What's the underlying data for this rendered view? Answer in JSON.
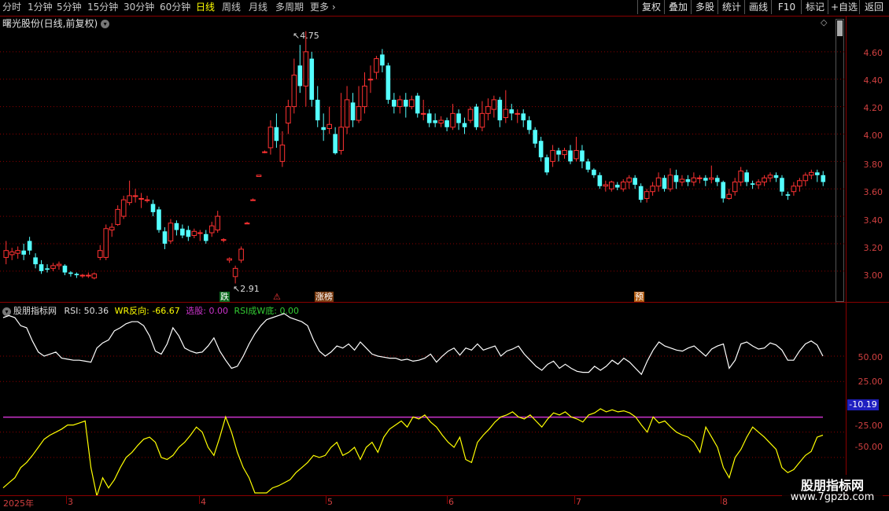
{
  "toolbar": {
    "periods": [
      "分时",
      "1分钟",
      "5分钟",
      "15分钟",
      "30分钟",
      "60分钟",
      "日线",
      "周线",
      "月线",
      "多周期",
      "更多"
    ],
    "active_period": "日线",
    "buttons": [
      "复权",
      "叠加",
      "多股",
      "统计",
      "画线",
      "F10",
      "标记",
      "+自选",
      "返回"
    ]
  },
  "chart": {
    "title": "曙光股份(日线,前复权)",
    "high_label": "4.75",
    "low_label": "2.91",
    "events": [
      {
        "text": "跌",
        "bg": "#0b6a1e",
        "color": "#ffffff"
      },
      {
        "text": "⚠",
        "bg": "#000000",
        "color": "#ff3a3a"
      },
      {
        "text": "涨榜",
        "bg": "#7a3b10",
        "color": "#ffffff"
      },
      {
        "text": "预",
        "bg": "#b05a10",
        "color": "#ffffff"
      }
    ],
    "xlabels": [
      "2025年",
      "3",
      "4",
      "5",
      "6",
      "7",
      "8"
    ]
  },
  "indicator": {
    "name": "股朋指标网",
    "rsi_label": "RSI:",
    "rsi_value": "50.36",
    "wr_label": "WR反向:",
    "wr_value": "-66.67",
    "sel_label": "选股:",
    "sel_value": "0.00",
    "w_label": "RSI成W底:",
    "w_value": "0.00",
    "current_value": "-10.19"
  },
  "watermark": {
    "line1": "股朋指标网",
    "line2": "www.7gpzb.com"
  },
  "colors": {
    "up": "#ff3232",
    "down": "#54ffff",
    "rsi": "#ffffff",
    "wr": "#ffff00",
    "magenta": "#cc33cc",
    "grid": "#8b0000"
  },
  "chart_data": [
    {
      "type": "candlestick",
      "title": "曙光股份(日线,前复权)",
      "ylim": [
        2.85,
        4.8
      ],
      "yticks": [
        3.0,
        3.2,
        3.4,
        3.6,
        3.8,
        4.0,
        4.2,
        4.4,
        4.6
      ],
      "ytick_labels": [
        "3.00",
        "3.20",
        "3.40",
        "3.60",
        "3.80",
        "4.00",
        "4.20",
        "4.40",
        "4.60"
      ],
      "x_labels": [
        "2025年",
        "3",
        "4",
        "5",
        "6",
        "7",
        "8"
      ],
      "annotations": [
        {
          "text": "4.75",
          "value": 4.75
        },
        {
          "text": "2.91",
          "value": 2.91
        }
      ],
      "ohlc": [
        [
          3.1,
          3.15,
          3.05,
          3.22
        ],
        [
          3.12,
          3.14,
          3.08,
          3.17
        ],
        [
          3.13,
          3.15,
          3.09,
          3.18
        ],
        [
          3.15,
          3.12,
          3.08,
          3.2
        ],
        [
          3.22,
          3.15,
          3.12,
          3.25
        ],
        [
          3.1,
          3.05,
          3.02,
          3.13
        ],
        [
          3.05,
          3.0,
          2.98,
          3.08
        ],
        [
          3.02,
          3.01,
          2.99,
          3.05
        ],
        [
          3.02,
          3.04,
          3.0,
          3.06
        ],
        [
          3.04,
          3.05,
          3.01,
          3.07
        ],
        [
          3.04,
          2.99,
          2.97,
          3.05
        ],
        [
          2.99,
          2.98,
          2.96,
          3.0
        ],
        [
          2.98,
          2.97,
          2.95,
          2.99
        ],
        [
          2.97,
          2.97,
          2.95,
          2.98
        ],
        [
          2.97,
          2.97,
          2.95,
          2.99
        ],
        [
          2.95,
          2.98,
          2.94,
          2.99
        ],
        [
          3.1,
          3.15,
          3.08,
          3.19
        ],
        [
          3.1,
          3.31,
          3.08,
          3.34
        ],
        [
          3.3,
          3.32,
          3.25,
          3.35
        ],
        [
          3.34,
          3.45,
          3.33,
          3.48
        ],
        [
          3.4,
          3.52,
          3.38,
          3.55
        ],
        [
          3.5,
          3.55,
          3.48,
          3.66
        ],
        [
          3.55,
          3.55,
          3.5,
          3.6
        ],
        [
          3.53,
          3.53,
          3.46,
          3.57
        ],
        [
          3.52,
          3.52,
          3.5,
          3.55
        ],
        [
          3.49,
          3.43,
          3.4,
          3.52
        ],
        [
          3.45,
          3.3,
          3.28,
          3.47
        ],
        [
          3.29,
          3.2,
          3.16,
          3.32
        ],
        [
          3.22,
          3.35,
          3.2,
          3.38
        ],
        [
          3.35,
          3.3,
          3.26,
          3.37
        ],
        [
          3.31,
          3.26,
          3.24,
          3.34
        ],
        [
          3.3,
          3.25,
          3.22,
          3.33
        ],
        [
          3.26,
          3.29,
          3.24,
          3.31
        ],
        [
          3.28,
          3.28,
          3.22,
          3.3
        ],
        [
          3.27,
          3.22,
          3.2,
          3.3
        ],
        [
          3.28,
          3.33,
          3.25,
          3.36
        ],
        [
          3.3,
          3.4,
          3.28,
          3.44
        ],
        [
          3.23,
          3.23,
          3.21,
          3.24
        ],
        [
          3.08,
          3.09,
          3.06,
          3.1
        ],
        [
          2.96,
          3.02,
          2.91,
          3.04
        ],
        [
          3.08,
          3.16,
          3.06,
          3.18
        ],
        [
          3.35,
          3.35,
          3.35,
          3.36
        ],
        [
          3.52,
          3.52,
          3.52,
          3.53
        ],
        [
          3.69,
          3.7,
          3.69,
          3.7
        ],
        [
          3.87,
          3.87,
          3.86,
          3.88
        ],
        [
          3.9,
          4.05,
          3.85,
          4.1
        ],
        [
          4.05,
          3.95,
          3.9,
          4.15
        ],
        [
          3.8,
          3.92,
          3.76,
          4.02
        ],
        [
          4.08,
          4.2,
          4.0,
          4.25
        ],
        [
          4.2,
          4.43,
          4.15,
          4.55
        ],
        [
          4.5,
          4.35,
          4.3,
          4.65
        ],
        [
          4.35,
          4.6,
          4.2,
          4.75
        ],
        [
          4.55,
          4.25,
          4.2,
          4.6
        ],
        [
          4.25,
          4.1,
          4.05,
          4.35
        ],
        [
          4.05,
          4.03,
          3.95,
          4.15
        ],
        [
          4.04,
          4.07,
          4.0,
          4.2
        ],
        [
          4.0,
          3.86,
          3.85,
          4.05
        ],
        [
          3.88,
          4.05,
          3.85,
          4.3
        ],
        [
          4.05,
          4.25,
          4.0,
          4.35
        ],
        [
          4.23,
          4.1,
          4.05,
          4.3
        ],
        [
          4.1,
          4.2,
          4.08,
          4.35
        ],
        [
          4.2,
          4.35,
          4.15,
          4.45
        ],
        [
          4.4,
          4.4,
          4.3,
          4.5
        ],
        [
          4.45,
          4.55,
          4.4,
          4.57
        ],
        [
          4.58,
          4.5,
          4.45,
          4.62
        ],
        [
          4.5,
          4.25,
          4.22,
          4.52
        ],
        [
          4.25,
          4.2,
          4.15,
          4.3
        ],
        [
          4.2,
          4.25,
          4.15,
          4.28
        ],
        [
          4.25,
          4.2,
          4.12,
          4.3
        ],
        [
          4.2,
          4.25,
          4.18,
          4.28
        ],
        [
          4.28,
          4.15,
          4.12,
          4.3
        ],
        [
          4.15,
          4.15,
          4.1,
          4.25
        ],
        [
          4.15,
          4.08,
          4.05,
          4.18
        ],
        [
          4.1,
          4.08,
          4.05,
          4.15
        ],
        [
          4.08,
          4.1,
          4.05,
          4.13
        ],
        [
          4.1,
          4.05,
          4.02,
          4.12
        ],
        [
          4.05,
          4.15,
          4.03,
          4.22
        ],
        [
          4.15,
          4.08,
          4.03,
          4.18
        ],
        [
          4.08,
          4.05,
          4.0,
          4.12
        ],
        [
          4.1,
          4.18,
          4.08,
          4.2
        ],
        [
          4.2,
          4.05,
          4.03,
          4.22
        ],
        [
          4.05,
          4.15,
          4.02,
          4.24
        ],
        [
          4.15,
          4.2,
          4.1,
          4.26
        ],
        [
          4.18,
          4.25,
          4.12,
          4.28
        ],
        [
          4.25,
          4.1,
          4.05,
          4.27
        ],
        [
          4.12,
          4.18,
          4.08,
          4.32
        ],
        [
          4.18,
          4.15,
          4.1,
          4.22
        ],
        [
          4.15,
          4.15,
          4.08,
          4.18
        ],
        [
          4.15,
          4.1,
          4.05,
          4.18
        ],
        [
          4.1,
          4.03,
          4.0,
          4.13
        ],
        [
          4.03,
          3.93,
          3.9,
          4.05
        ],
        [
          3.95,
          3.83,
          3.8,
          3.98
        ],
        [
          3.83,
          3.72,
          3.7,
          3.85
        ],
        [
          3.8,
          3.88,
          3.76,
          3.92
        ],
        [
          3.88,
          3.85,
          3.8,
          3.9
        ],
        [
          3.85,
          3.88,
          3.82,
          3.9
        ],
        [
          3.88,
          3.8,
          3.78,
          3.92
        ],
        [
          3.82,
          3.88,
          3.8,
          3.98
        ],
        [
          3.88,
          3.8,
          3.75,
          3.92
        ],
        [
          3.8,
          3.74,
          3.72,
          3.82
        ],
        [
          3.74,
          3.7,
          3.68,
          3.75
        ],
        [
          3.7,
          3.62,
          3.6,
          3.72
        ],
        [
          3.62,
          3.63,
          3.58,
          3.66
        ],
        [
          3.6,
          3.65,
          3.58,
          3.66
        ],
        [
          3.63,
          3.61,
          3.59,
          3.65
        ],
        [
          3.6,
          3.65,
          3.58,
          3.67
        ],
        [
          3.65,
          3.68,
          3.6,
          3.7
        ],
        [
          3.68,
          3.63,
          3.6,
          3.7
        ],
        [
          3.62,
          3.52,
          3.5,
          3.64
        ],
        [
          3.53,
          3.58,
          3.5,
          3.6
        ],
        [
          3.58,
          3.62,
          3.55,
          3.65
        ],
        [
          3.62,
          3.68,
          3.58,
          3.72
        ],
        [
          3.68,
          3.6,
          3.58,
          3.7
        ],
        [
          3.6,
          3.7,
          3.58,
          3.75
        ],
        [
          3.7,
          3.65,
          3.6,
          3.74
        ],
        [
          3.65,
          3.67,
          3.62,
          3.7
        ],
        [
          3.67,
          3.65,
          3.62,
          3.7
        ],
        [
          3.65,
          3.68,
          3.62,
          3.72
        ],
        [
          3.68,
          3.68,
          3.64,
          3.7
        ],
        [
          3.68,
          3.66,
          3.62,
          3.7
        ],
        [
          3.67,
          3.68,
          3.64,
          3.77
        ],
        [
          3.68,
          3.65,
          3.62,
          3.7
        ],
        [
          3.65,
          3.53,
          3.5,
          3.66
        ],
        [
          3.53,
          3.56,
          3.52,
          3.6
        ],
        [
          3.58,
          3.65,
          3.55,
          3.68
        ],
        [
          3.65,
          3.73,
          3.62,
          3.76
        ],
        [
          3.72,
          3.65,
          3.62,
          3.74
        ],
        [
          3.64,
          3.63,
          3.6,
          3.66
        ],
        [
          3.63,
          3.65,
          3.6,
          3.67
        ],
        [
          3.65,
          3.68,
          3.62,
          3.7
        ],
        [
          3.68,
          3.7,
          3.65,
          3.72
        ],
        [
          3.7,
          3.68,
          3.65,
          3.72
        ],
        [
          3.68,
          3.58,
          3.55,
          3.7
        ],
        [
          3.56,
          3.55,
          3.52,
          3.58
        ],
        [
          3.58,
          3.62,
          3.55,
          3.65
        ],
        [
          3.62,
          3.66,
          3.58,
          3.68
        ],
        [
          3.66,
          3.7,
          3.62,
          3.72
        ],
        [
          3.7,
          3.72,
          3.67,
          3.74
        ],
        [
          3.72,
          3.7,
          3.65,
          3.74
        ],
        [
          3.7,
          3.65,
          3.62,
          3.73
        ]
      ]
    },
    {
      "type": "line",
      "title": "股朋指标网",
      "ylim": [
        -85,
        95
      ],
      "ytick_labels": [
        "50.00",
        "25.00",
        "-25.00",
        "-50.00"
      ],
      "reference_line": -10.19,
      "series": [
        {
          "name": "RSI",
          "values": [
            88,
            90,
            88,
            80,
            78,
            65,
            54,
            50,
            52,
            54,
            48,
            47,
            46,
            46,
            45,
            44,
            58,
            63,
            66,
            75,
            78,
            82,
            84,
            84,
            80,
            70,
            55,
            52,
            62,
            78,
            70,
            58,
            55,
            53,
            54,
            60,
            68,
            55,
            46,
            38,
            40,
            50,
            62,
            72,
            80,
            86,
            88,
            90,
            92,
            88,
            86,
            84,
            80,
            66,
            55,
            50,
            54,
            60,
            58,
            62,
            56,
            64,
            58,
            52,
            50,
            49,
            48,
            48,
            46,
            47,
            45,
            46,
            48,
            52,
            44,
            50,
            55,
            58,
            51,
            58,
            56,
            62,
            56,
            58,
            60,
            50,
            55,
            57,
            60,
            52,
            46,
            40,
            36,
            42,
            45,
            38,
            42,
            38,
            35,
            34,
            34,
            40,
            36,
            40,
            46,
            42,
            48,
            44,
            38,
            32,
            45,
            56,
            64,
            60,
            58,
            56,
            55,
            58,
            60,
            55,
            50,
            57,
            60,
            62,
            38,
            46,
            62,
            64,
            60,
            57,
            58,
            63,
            61,
            56,
            46,
            46,
            55,
            62,
            65,
            61,
            50
          ]
        },
        {
          "name": "WR反向",
          "values": [
            -80,
            -75,
            -70,
            -60,
            -55,
            -48,
            -40,
            -32,
            -28,
            -25,
            -22,
            -18,
            -18,
            -16,
            -14,
            -60,
            -88,
            -70,
            -80,
            -72,
            -60,
            -50,
            -45,
            -38,
            -32,
            -30,
            -35,
            -50,
            -52,
            -48,
            -40,
            -35,
            -28,
            -20,
            -25,
            -40,
            -48,
            -30,
            -10,
            -25,
            -45,
            -60,
            -70,
            -85,
            -85,
            -85,
            -80,
            -78,
            -75,
            -72,
            -65,
            -60,
            -55,
            -48,
            -50,
            -48,
            -40,
            -35,
            -48,
            -45,
            -40,
            -52,
            -40,
            -35,
            -45,
            -30,
            -22,
            -18,
            -14,
            -20,
            -10,
            -12,
            -8,
            -15,
            -20,
            -28,
            -35,
            -40,
            -30,
            -52,
            -55,
            -35,
            -28,
            -22,
            -15,
            -10,
            -8,
            -5,
            -10,
            -12,
            -8,
            -14,
            -20,
            -12,
            -6,
            -8,
            -5,
            -10,
            -12,
            -15,
            -8,
            -6,
            -2,
            -5,
            -3,
            -5,
            -4,
            -6,
            -10,
            -18,
            -25,
            -10,
            -16,
            -14,
            -20,
            -25,
            -28,
            -30,
            -35,
            -45,
            -20,
            -30,
            -40,
            -60,
            -70,
            -50,
            -42,
            -30,
            -20,
            -25,
            -30,
            -36,
            -42,
            -60,
            -65,
            -62,
            -55,
            -48,
            -44,
            -30,
            -28
          ]
        }
      ]
    }
  ]
}
